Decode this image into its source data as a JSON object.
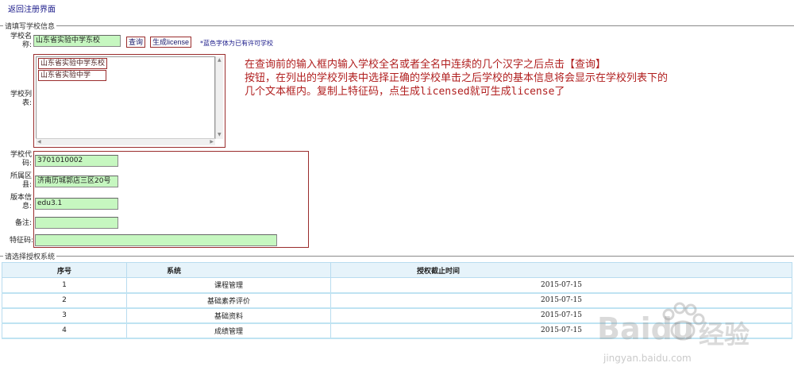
{
  "header": {
    "back_link": "返回注册界面"
  },
  "school_info": {
    "legend": "请填写学校信息",
    "name_label_1": "学校名",
    "name_label_2": "称:",
    "name_value": "山东省实验中学东校",
    "query_button": "查询",
    "generate_button": "生成license",
    "hint": "*蓝色字体为已有许可学校",
    "list_label_1": "学校列",
    "list_label_2": "表:",
    "list_items": [
      "山东省实验中学东校",
      "山东省实验中学"
    ],
    "code_label_1": "学校代",
    "code_label_2": "码:",
    "code_value": "3701010002",
    "district_label_1": "所属区",
    "district_label_2": "县:",
    "district_value": "济南历城郭店三区20号",
    "version_label_1": "版本信",
    "version_label_2": "息:",
    "version_value": "edu3.1",
    "remark_label": "备注:",
    "remark_value": "",
    "feature_label": "特征码:",
    "feature_value": ""
  },
  "annotation": {
    "line1": "在查询前的输入框内输入学校全名或者全名中连续的几个汉字之后点击【查询】",
    "line2": "按钮，在列出的学校列表中选择正确的学校单击之后学校的基本信息将会显示在学校列表下的",
    "line3": "几个文本框内。复制上特征码，点生成licensed就可生成license了"
  },
  "auth_systems": {
    "legend": "请选择授权系统",
    "headers": [
      "序号",
      "系统",
      "授权截止时间"
    ],
    "rows": [
      {
        "no": "1",
        "system": "课程管理",
        "expires": "2015-07-15"
      },
      {
        "no": "2",
        "system": "基础素养评价",
        "expires": "2015-07-15"
      },
      {
        "no": "3",
        "system": "基础资料",
        "expires": "2015-07-15"
      },
      {
        "no": "4",
        "system": "成绩管理",
        "expires": "2015-07-15"
      }
    ]
  },
  "watermark": {
    "brand": "Baidu",
    "brand_cn": "经验",
    "url": "jingyan.baidu.com"
  }
}
